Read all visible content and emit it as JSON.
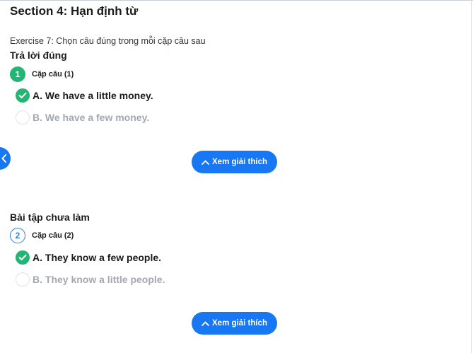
{
  "section_title": "Section 4: Hạn định từ",
  "exercise_text": "Exercise 7: Chọn câu đúng trong mỗi cặp câu sau",
  "questions": [
    {
      "status": "Trả lời đúng",
      "number": "1",
      "label": "Cặp câu (1)",
      "options": [
        {
          "text": "A. We have a little money.",
          "state": "selected-correct"
        },
        {
          "text": "B. We have a few money.",
          "state": "unselected"
        }
      ],
      "explain_label": "Xem giải thích"
    },
    {
      "status": "Bài tập chưa làm",
      "number": "2",
      "label": "Cặp câu (2)",
      "options": [
        {
          "text": "A. They know a few people.",
          "state": "selected-correct"
        },
        {
          "text": "B. They know a little people.",
          "state": "unselected"
        }
      ],
      "explain_label": "Xem giải thích"
    }
  ],
  "colors": {
    "accent_blue": "#1877f2",
    "correct_green": "#22b573",
    "muted_text": "#a3a8b0"
  }
}
